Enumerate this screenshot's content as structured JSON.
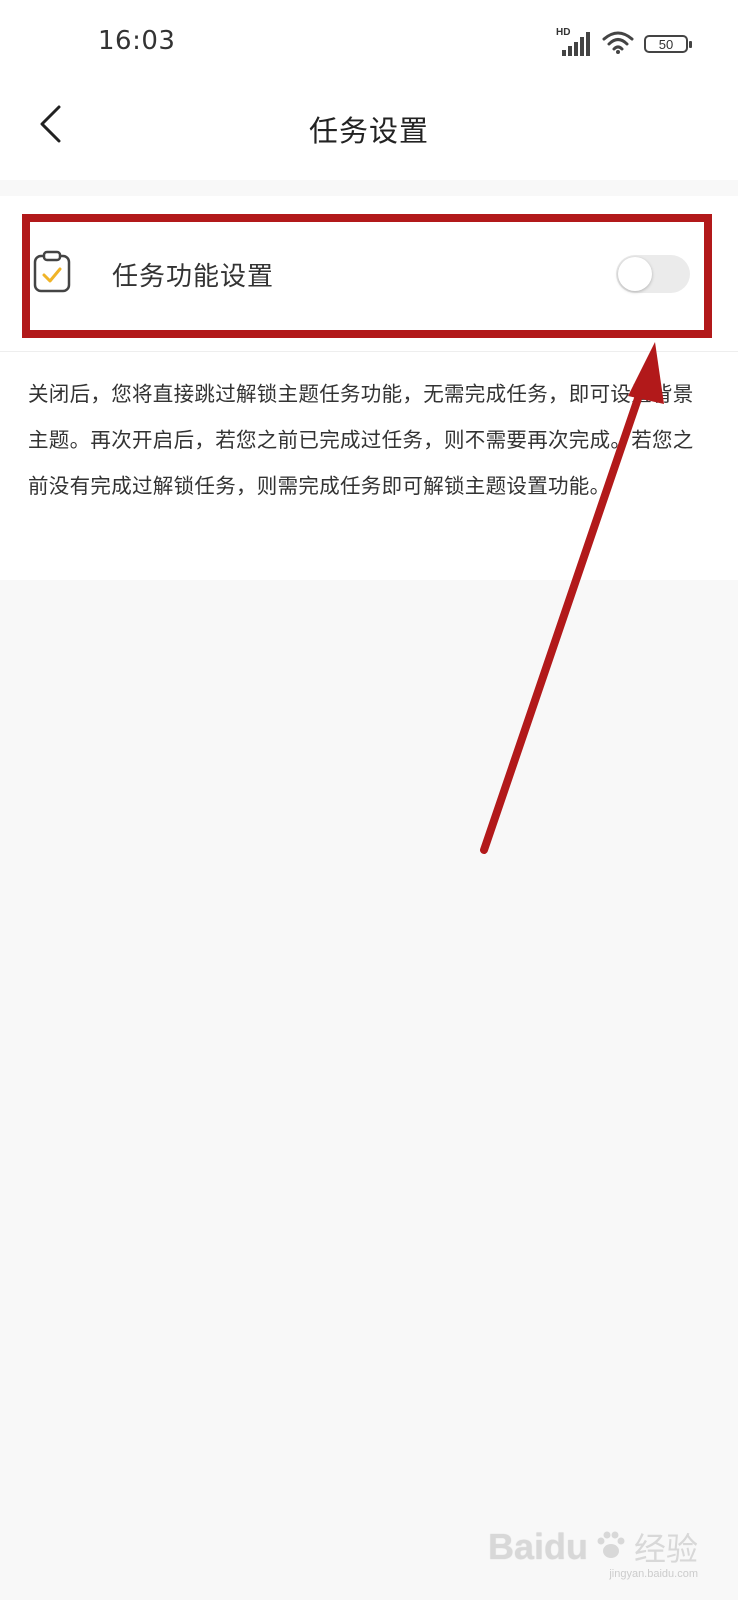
{
  "status_bar": {
    "time": "16:03",
    "network_label": "HD",
    "battery_level": "50",
    "icons": [
      "signal-icon",
      "wifi-icon",
      "battery-icon"
    ]
  },
  "header": {
    "title": "任务设置",
    "back_icon": "chevron-left-icon"
  },
  "setting": {
    "icon": "clipboard-check-icon",
    "label": "任务功能设置",
    "toggle_on": false
  },
  "description": "关闭后，您将直接跳过解锁主题任务功能，无需完成任务，即可设置背景主题。再次开启后，若您之前已完成过任务，则不需要再次完成。若您之前没有完成过解锁任务，则需完成任务即可解锁主题设置功能。",
  "watermark": {
    "brand": "Baidu",
    "cn": "经验",
    "url": "jingyan.baidu.com"
  },
  "colors": {
    "annotation_red": "#b2191a",
    "icon_accent": "#f0b428",
    "toggle_off": "#ebebeb",
    "background": "#f8f8f8"
  }
}
